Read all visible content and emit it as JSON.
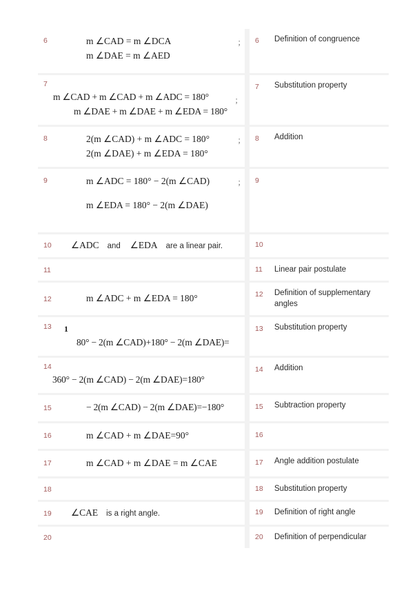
{
  "document": {
    "type": "two-column-proof-table",
    "column_count": 2,
    "row_count": 15,
    "number_color": "#a35a5a",
    "row_background": "#ffffff",
    "table_background": "#f2f2f2",
    "page_background": "#ffffff"
  },
  "rows": [
    {
      "number": "6",
      "reason_number": "6",
      "statement_lines": [
        "m ∠CAD  =  m ∠DCA",
        "m ∠DAE  =  m ∠AED"
      ],
      "has_semicolon": true,
      "reason": "Definition of congruence"
    },
    {
      "number": "7",
      "reason_number": "7",
      "statement_lines": [
        "m ∠CAD  +  m ∠CAD  +  m ∠ADC  =  180°",
        "m ∠DAE  +  m ∠DAE  +  m ∠EDA  =  180°"
      ],
      "has_semicolon": true,
      "reason": "Substitution property"
    },
    {
      "number": "8",
      "reason_number": "8",
      "statement_lines": [
        "2(m ∠CAD)  +  m ∠ADC  =  180°",
        "2(m ∠DAE)  +  m ∠EDA  =  180°"
      ],
      "has_semicolon": true,
      "reason": "Addition"
    },
    {
      "number": "9",
      "reason_number": "9",
      "statement_lines": [
        "m ∠ADC  =  180°  −  2(m ∠CAD)",
        "m ∠EDA  =  180°  −  2(m ∠DAE)"
      ],
      "has_semicolon": true,
      "reason": ""
    },
    {
      "number": "10",
      "reason_number": "10",
      "statement_mixed": {
        "math1": "∠ADC",
        "text1": "and",
        "math2": "∠EDA",
        "text2": "are a linear pair."
      },
      "reason": ""
    },
    {
      "number": "11",
      "reason_number": "11",
      "statement_lines": [],
      "reason": "Linear pair postulate"
    },
    {
      "number": "12",
      "reason_number": "12",
      "statement_lines": [
        "m ∠ADC  +  m ∠EDA  =  180°"
      ],
      "reason": "Definition of supplementary angles"
    },
    {
      "number": "13",
      "reason_number": "13",
      "statement_lines": [
        "1",
        "80°  −  2(m ∠CAD)+180°  −  2(m ∠DAE)="
      ],
      "reason": "Substitution property"
    },
    {
      "number": "14",
      "reason_number": "14",
      "statement_lines": [
        "360°  −  2(m ∠CAD)  −  2(m ∠DAE)=180°"
      ],
      "reason": "Addition"
    },
    {
      "number": "15",
      "reason_number": "15",
      "statement_lines": [
        "−  2(m ∠CAD)  −  2(m ∠DAE)=−180°"
      ],
      "reason": "Subtraction property"
    },
    {
      "number": "16",
      "reason_number": "16",
      "statement_lines": [
        "m ∠CAD  +  m ∠DAE=90°"
      ],
      "reason": ""
    },
    {
      "number": "17",
      "reason_number": "17",
      "statement_lines": [
        "m ∠CAD  +  m ∠DAE  =  m ∠CAE"
      ],
      "reason": "Angle addition postulate"
    },
    {
      "number": "18",
      "reason_number": "18",
      "statement_lines": [],
      "reason": "Substitution property"
    },
    {
      "number": "19",
      "reason_number": "19",
      "statement_mixed": {
        "math1": "∠CAE",
        "text1": "is a right angle.",
        "math2": "",
        "text2": ""
      },
      "reason": "Definition of right angle"
    },
    {
      "number": "20",
      "reason_number": "20",
      "statement_lines": [],
      "reason": "Definition of perpendicular"
    }
  ]
}
